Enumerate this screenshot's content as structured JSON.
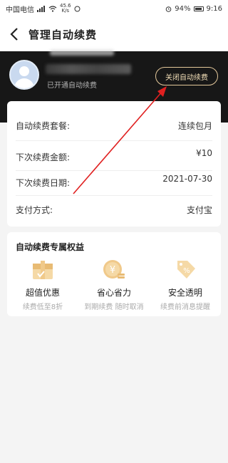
{
  "status_bar": {
    "carrier": "中国电信",
    "speed_value": "45.6",
    "speed_unit": "K/s",
    "right_info": "94%",
    "time": "9:16"
  },
  "header": {
    "back_icon": "chevron-left-icon",
    "title": "管理自动续费"
  },
  "profile": {
    "member_status": "已开通自动续费",
    "cancel_button": "关闭自动续费"
  },
  "info": {
    "rows": [
      {
        "label": "自动续费套餐:",
        "value": "连续包月"
      },
      {
        "label": "下次续费金额:",
        "value": "¥10"
      },
      {
        "label": "下次续费日期:",
        "value": "2021-07-30"
      },
      {
        "label": "支付方式:",
        "value": "支付宝"
      }
    ]
  },
  "benefits": {
    "title": "自动续费专属权益",
    "items": [
      {
        "name": "超值优惠",
        "desc": "续费低至8折",
        "icon": "gift-envelope-icon"
      },
      {
        "name": "省心省力",
        "desc": "到期续费 随时取消",
        "icon": "coin-icon"
      },
      {
        "name": "安全透明",
        "desc": "续费前消息提醒",
        "icon": "discount-tag-icon"
      }
    ]
  },
  "colors": {
    "accent_gold": "#e3c79a",
    "dark_band": "#171717",
    "annotation_red": "#e02020"
  }
}
